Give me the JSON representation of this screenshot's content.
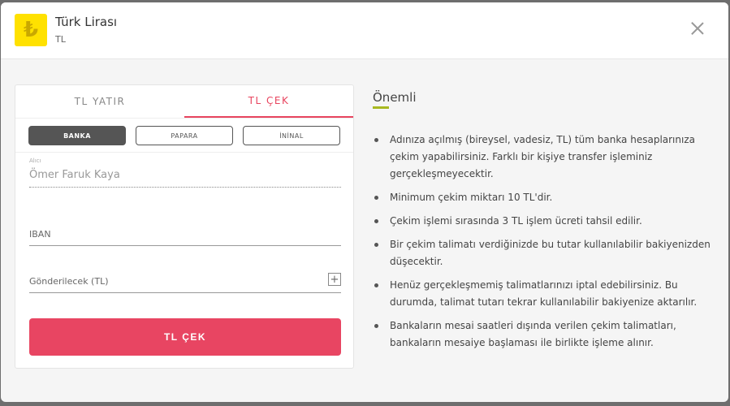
{
  "header": {
    "icon_glyph": "₺",
    "title": "Türk Lirası",
    "subtitle": "TL"
  },
  "tabs": [
    {
      "label": "TL YATIR",
      "active": false
    },
    {
      "label": "TL ÇEK",
      "active": true
    }
  ],
  "methods": [
    {
      "label": "BANKA",
      "active": true
    },
    {
      "label": "PAPARA",
      "active": false
    },
    {
      "label": "İNİNAL",
      "active": false
    }
  ],
  "form": {
    "recipient_label": "Alıcı",
    "recipient_value": "Ömer Faruk Kaya",
    "iban_placeholder": "IBAN",
    "amount_placeholder": "Gönderilecek (TL)",
    "submit_label": "TL ÇEK"
  },
  "info": {
    "title": "Önemli",
    "items": [
      "Adınıza açılmış (bireysel, vadesiz, TL) tüm banka hesaplarınıza çekim yapabilirsiniz. Farklı bir kişiye transfer işleminiz gerçekleşmeyecektir.",
      "Minimum çekim miktarı 10 TL'dir.",
      "Çekim işlemi sırasında 3 TL işlem ücreti tahsil edilir.",
      "Bir çekim talimatı verdiğinizde bu tutar kullanılabilir bakiyenizden düşecektir.",
      "Henüz gerçekleşmemiş talimatlarınızı iptal edebilirsiniz. Bu durumda, talimat tutarı tekrar kullanılabilir bakiyenize aktarılır.",
      "Bankaların mesai saatleri dışında verilen çekim talimatları, bankaların mesaiye başlaması ile birlikte işleme alınır."
    ]
  },
  "colors": {
    "accent": "#e84562",
    "currency_icon_bg": "#ffe100",
    "info_underline": "#a8b820"
  }
}
